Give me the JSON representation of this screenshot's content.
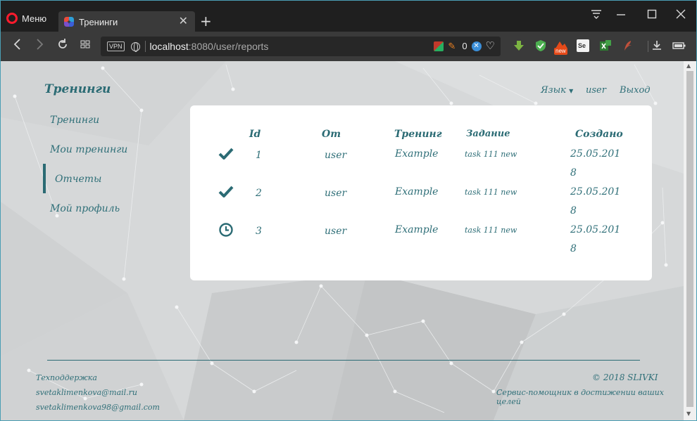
{
  "browser": {
    "menu_label": "Меню",
    "tab_title": "Тренинги",
    "url_host": "localhost",
    "url_rest": ":8080/user/reports",
    "vpn_label": "VPN",
    "blocked_count": "0",
    "extensions": [
      "download-ext-icon",
      "shield-ext-icon",
      "new-badge-ext-icon",
      "selenium-ext-icon",
      "excel-ext-icon",
      "feather-ext-icon"
    ],
    "new_badge": "new",
    "se_badge": "Se"
  },
  "site": {
    "brand": "Тренинги",
    "sidebar": {
      "items": [
        {
          "label": "Тренинги"
        },
        {
          "label": "Мои тренинги"
        },
        {
          "label": "Отчеты"
        },
        {
          "label": "Мой профиль"
        }
      ]
    },
    "topnav": {
      "language": "Язык",
      "user": "user",
      "logout": "Выход"
    }
  },
  "reports": {
    "headers": {
      "id": "Id",
      "from": "От",
      "training": "Тренинг",
      "task": "Задание",
      "created": "Создано"
    },
    "rows": [
      {
        "status_icon": "checkmark-icon",
        "id": "1",
        "from": "user",
        "training": "Example",
        "task": "task 111 new",
        "created_1": "25.05.201",
        "created_2": "8"
      },
      {
        "status_icon": "checkmark-icon",
        "id": "2",
        "from": "user",
        "training": "Example",
        "task": "task 111 new",
        "created_1": "25.05.201",
        "created_2": "8"
      },
      {
        "status_icon": "clock-icon",
        "id": "3",
        "from": "user",
        "training": "Example",
        "task": "task 111 new",
        "created_1": "25.05.201",
        "created_2": "8"
      }
    ]
  },
  "footer": {
    "support_label": "Техподдержка",
    "email_1": "svetaklimenkova@mail.ru",
    "email_2": "svetaklimenkova98@gmail.com",
    "copyright": "© 2018 SLIVKI",
    "tagline": "Сервис-помощник в достижении ваших целей"
  },
  "colors": {
    "accent": "#2b6b74",
    "page_bg": "#d6d8d9",
    "card_bg": "#ffffff",
    "browser_chrome": "#3a3a3a"
  }
}
